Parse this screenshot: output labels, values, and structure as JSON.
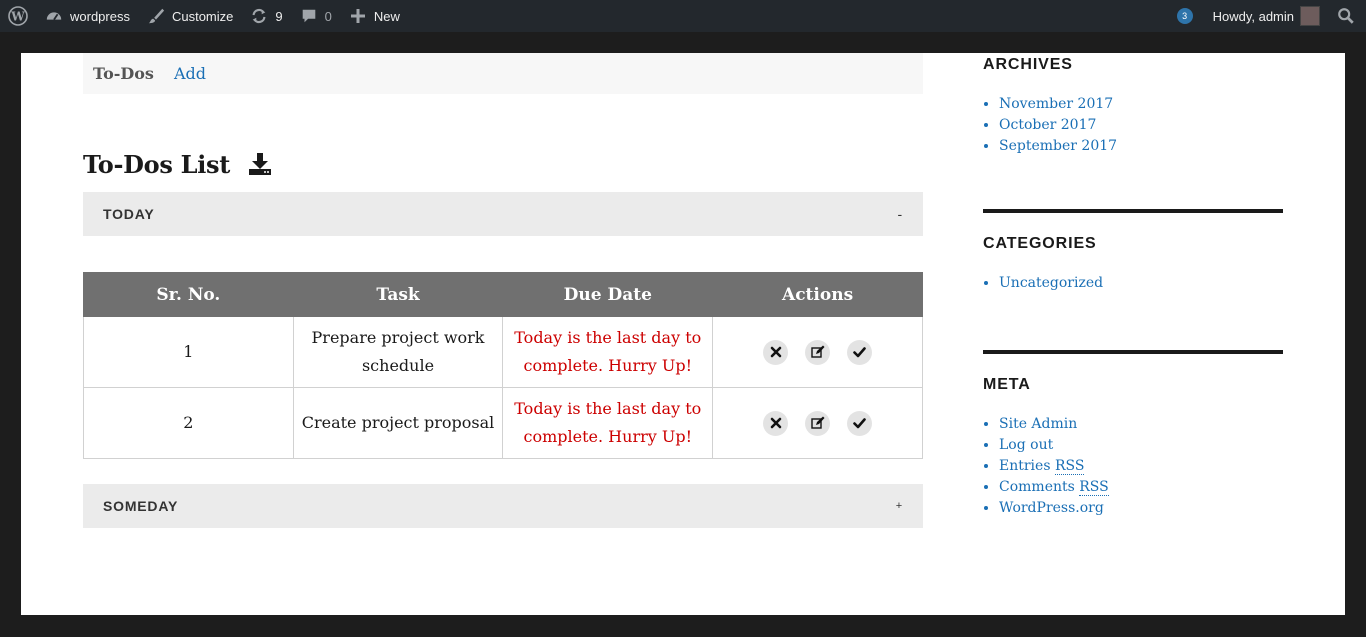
{
  "adminbar": {
    "site_name": "wordpress",
    "customize": "Customize",
    "updates_count": "9",
    "comments_count": "0",
    "new_label": "New",
    "notifications": "3",
    "howdy": "Howdy, admin"
  },
  "subnav": {
    "current": "To-Dos",
    "add": "Add"
  },
  "list_title": "To-Dos List",
  "sections": {
    "today": {
      "label": "TODAY",
      "toggle": "-"
    },
    "someday": {
      "label": "SOMEDAY",
      "toggle": "+"
    }
  },
  "table": {
    "headers": [
      "Sr. No.",
      "Task",
      "Due Date",
      "Actions"
    ],
    "rows": [
      {
        "sr": "1",
        "task": "Prepare project work schedule",
        "due": "Today is the last day to complete. Hurry Up!"
      },
      {
        "sr": "2",
        "task": "Create project proposal",
        "due": "Today is the last day to complete. Hurry Up!"
      }
    ]
  },
  "sidebar": {
    "archives": {
      "title": "ARCHIVES",
      "items": [
        "November 2017",
        "October 2017",
        "September 2017"
      ]
    },
    "categories": {
      "title": "CATEGORIES",
      "items": [
        "Uncategorized"
      ]
    },
    "meta": {
      "title": "META",
      "items": [
        "Site Admin",
        "Log out",
        "Entries",
        "Comments",
        "WordPress.org"
      ],
      "rss": "RSS"
    }
  },
  "colors": {
    "link": "#1a6fb5",
    "due_warning": "#cc0000",
    "table_header": "#707070",
    "adminbar": "#23282d"
  }
}
